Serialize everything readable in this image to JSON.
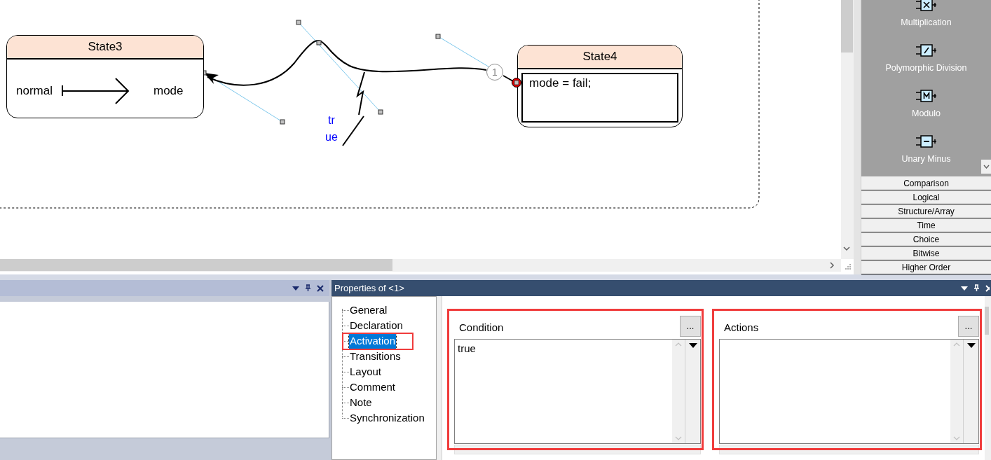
{
  "diagram": {
    "states": [
      {
        "title": "State3",
        "kind": "mapping",
        "source": "normal",
        "target": "mode"
      },
      {
        "title": "State4",
        "kind": "action",
        "action": "mode = fail;"
      }
    ],
    "transition": {
      "priority": "1",
      "label_lines": [
        "tr",
        "ue"
      ]
    }
  },
  "palette": {
    "tools": [
      {
        "label": "Multiplication",
        "kind": "multiply"
      },
      {
        "label": "Polymorphic Division",
        "kind": "divide"
      },
      {
        "label": "Modulo",
        "kind": "modulo"
      },
      {
        "label": "Unary Minus",
        "kind": "minus"
      }
    ],
    "categories": [
      "Comparison",
      "Logical",
      "Structure/Array",
      "Time",
      "Choice",
      "Bitwise",
      "Higher Order"
    ]
  },
  "properties": {
    "title": "Properties of <1>",
    "tree": [
      {
        "label": "General",
        "selected": false,
        "highlighted": false
      },
      {
        "label": "Declaration",
        "selected": false,
        "highlighted": false
      },
      {
        "label": "Activation",
        "selected": true,
        "highlighted": true
      },
      {
        "label": "Transitions",
        "selected": false,
        "highlighted": false
      },
      {
        "label": "Layout",
        "selected": false,
        "highlighted": false
      },
      {
        "label": "Comment",
        "selected": false,
        "highlighted": false
      },
      {
        "label": "Note",
        "selected": false,
        "highlighted": false
      },
      {
        "label": "Synchronization",
        "selected": false,
        "highlighted": false
      }
    ],
    "sections": [
      {
        "label": "Condition",
        "button": "...",
        "value": "true",
        "highlighted": true
      },
      {
        "label": "Actions",
        "button": "...",
        "highlighted": true
      }
    ]
  }
}
